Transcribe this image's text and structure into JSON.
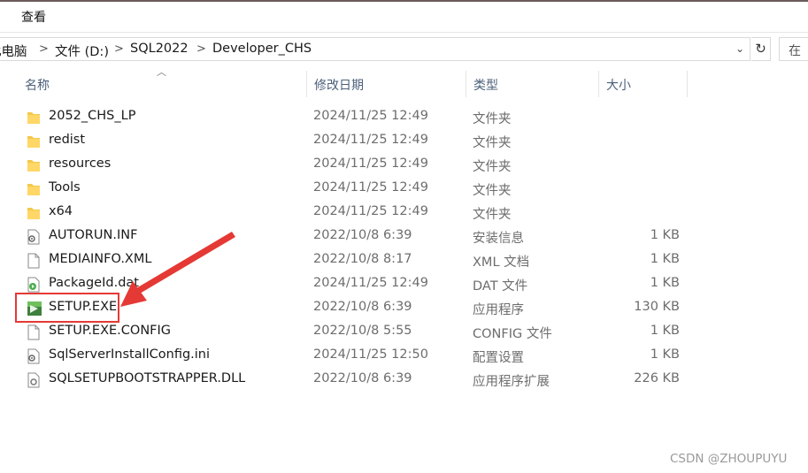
{
  "ribbon": {
    "tab_view": "查看"
  },
  "address": {
    "crumbs": [
      "此电脑",
      "文件 (D:)",
      "SQL2022",
      "Developer_CHS"
    ],
    "separator": ">",
    "dropdown": "⌄",
    "refresh": "↻"
  },
  "search": {
    "placeholder": "在"
  },
  "columns": {
    "name": "名称",
    "modified": "修改日期",
    "type": "类型",
    "size": "大小"
  },
  "files": [
    {
      "name": "2052_CHS_LP",
      "date": "2024/11/25 12:49",
      "type": "文件夹",
      "size": "",
      "icon": "folder-icon"
    },
    {
      "name": "redist",
      "date": "2024/11/25 12:49",
      "type": "文件夹",
      "size": "",
      "icon": "folder-icon"
    },
    {
      "name": "resources",
      "date": "2024/11/25 12:49",
      "type": "文件夹",
      "size": "",
      "icon": "folder-icon"
    },
    {
      "name": "Tools",
      "date": "2024/11/25 12:49",
      "type": "文件夹",
      "size": "",
      "icon": "folder-icon"
    },
    {
      "name": "x64",
      "date": "2024/11/25 12:49",
      "type": "文件夹",
      "size": "",
      "icon": "folder-icon"
    },
    {
      "name": "AUTORUN.INF",
      "date": "2022/10/8 6:39",
      "type": "安装信息",
      "size": "1 KB",
      "icon": "settings-file-icon"
    },
    {
      "name": "MEDIAINFO.XML",
      "date": "2022/10/8 8:17",
      "type": "XML 文档",
      "size": "1 KB",
      "icon": "document-icon"
    },
    {
      "name": "PackageId.dat",
      "date": "2024/11/25 12:49",
      "type": "DAT 文件",
      "size": "1 KB",
      "icon": "media-file-icon"
    },
    {
      "name": "SETUP.EXE",
      "date": "2022/10/8 6:39",
      "type": "应用程序",
      "size": "130 KB",
      "icon": "setup-exe-icon"
    },
    {
      "name": "SETUP.EXE.CONFIG",
      "date": "2022/10/8 5:55",
      "type": "CONFIG 文件",
      "size": "1 KB",
      "icon": "document-icon"
    },
    {
      "name": "SqlServerInstallConfig.ini",
      "date": "2024/11/25 12:50",
      "type": "配置设置",
      "size": "1 KB",
      "icon": "settings-file-icon"
    },
    {
      "name": "SQLSETUPBOOTSTRAPPER.DLL",
      "date": "2022/10/8 6:39",
      "type": "应用程序扩展",
      "size": "226 KB",
      "icon": "dll-file-icon"
    }
  ],
  "watermark": "CSDN @ZHOUPUYU",
  "colors": {
    "folder": "#f2c94c",
    "annotation": "#e53935",
    "header_text": "#4c607a"
  }
}
